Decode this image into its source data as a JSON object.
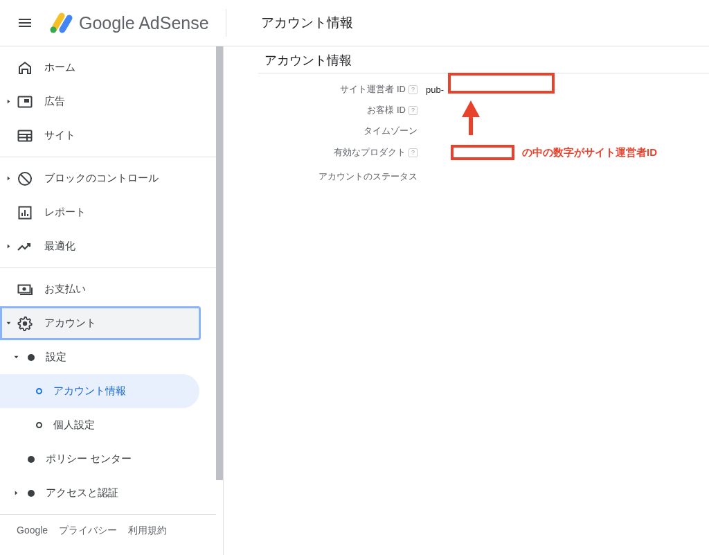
{
  "header": {
    "product": "Google AdSense",
    "title": "アカウント情報"
  },
  "sidebar": {
    "groups": [
      {
        "items": [
          {
            "label": "ホーム",
            "selected": false,
            "focused": false
          },
          {
            "label": "広告",
            "selected": false,
            "focused": false,
            "expanded": false
          },
          {
            "label": "サイト",
            "selected": false,
            "focused": false
          }
        ]
      },
      {
        "items": [
          {
            "label": "ブロックのコントロール",
            "selected": false,
            "focused": false,
            "expanded": false
          },
          {
            "label": "レポート",
            "selected": false,
            "focused": false
          },
          {
            "label": "最適化",
            "selected": false,
            "focused": false,
            "expanded": false
          }
        ]
      },
      {
        "items": [
          {
            "label": "お支払い",
            "selected": false,
            "focused": false
          },
          {
            "label": "アカウント",
            "selected": false,
            "focused": true,
            "expanded": true,
            "children": [
              {
                "label": "設定",
                "selected": false,
                "expanded": true,
                "children": [
                  {
                    "label": "アカウント情報",
                    "selected": true
                  },
                  {
                    "label": "個人設定",
                    "selected": false
                  }
                ]
              },
              {
                "label": "ポリシー センター",
                "selected": false
              },
              {
                "label": "アクセスと認証",
                "selected": false,
                "expanded": false
              }
            ]
          }
        ]
      }
    ],
    "footer": [
      "Google",
      "プライバシー",
      "利用規約"
    ]
  },
  "content": {
    "heading": "アカウント情報",
    "fields": [
      {
        "label": "サイト運営者 ID",
        "help": "?",
        "value": "pub-"
      },
      {
        "label": "お客様 ID",
        "help": "?"
      },
      {
        "label": "タイムゾーン"
      },
      {
        "label": "有効なプロダクト",
        "help": "?"
      },
      {
        "label": "アカウントのステータス"
      }
    ]
  },
  "annotation": {
    "text": "の中の数字がサイト運営者ID"
  }
}
